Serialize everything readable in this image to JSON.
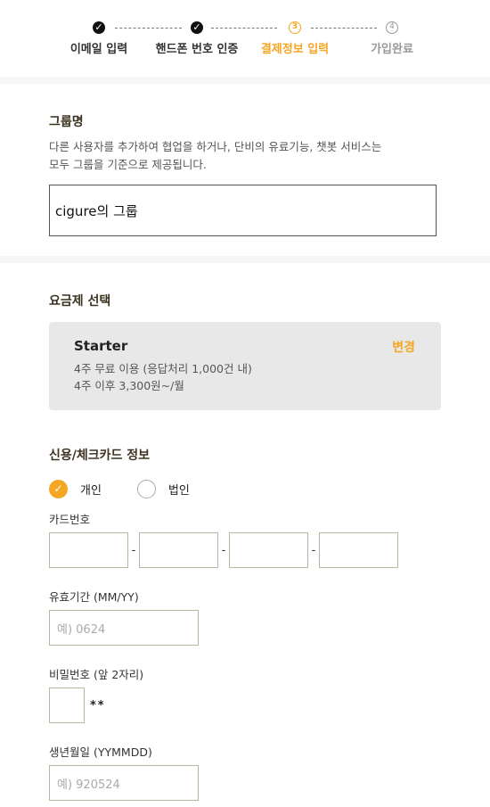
{
  "stepper": {
    "steps": [
      {
        "mark": "✓",
        "label": "이메일 입력"
      },
      {
        "mark": "✓",
        "label": "핸드폰 번호 인증"
      },
      {
        "mark": "3",
        "label": "결제정보 입력"
      },
      {
        "mark": "4",
        "label": "가입완료"
      }
    ],
    "current_color": "#f5a623"
  },
  "group": {
    "title": "그룹명",
    "desc_line1": "다른 사용자를 추가하여 협업을 하거나, 단비의 유료기능, 챗봇 서비스는",
    "desc_line2": "모두 그룹을 기준으로 제공됩니다.",
    "input_value": "cigure의 그룹"
  },
  "plan": {
    "title": "요금제 선택",
    "name": "Starter",
    "change_label": "변경",
    "line1": "4주 무료 이용 (응답처리 1,000건 내)",
    "line2": "4주 이후 3,300원~/월"
  },
  "card": {
    "title": "신용/체크카드 정보",
    "type_options": [
      "개인",
      "법인"
    ],
    "type_selected": "개인",
    "card_number_label": "카드번호",
    "separator": "-",
    "expiry_label": "유효기간 (MM/YY)",
    "expiry_placeholder": "예) 0624",
    "password_label": "비밀번호 (앞 2자리)",
    "password_mask": "**",
    "birth_label": "생년월일 (YYMMDD)",
    "birth_placeholder": "예) 920524"
  }
}
